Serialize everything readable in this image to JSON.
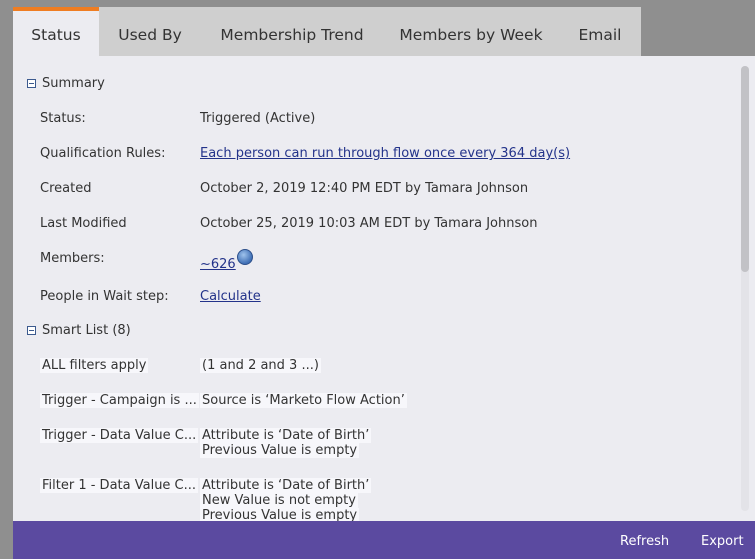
{
  "tabs": [
    {
      "label": "Status",
      "active": true
    },
    {
      "label": "Used By"
    },
    {
      "label": "Membership Trend"
    },
    {
      "label": "Members by Week"
    },
    {
      "label": "Email"
    }
  ],
  "summary": {
    "title": "Summary",
    "rows": {
      "status": {
        "label": "Status:",
        "value": "Triggered (Active)"
      },
      "qualification": {
        "label": "Qualification Rules:",
        "value": "Each person can run through flow once every 364 day(s)"
      },
      "created": {
        "label": "Created",
        "value": "October 2, 2019 12:40 PM EDT by Tamara Johnson"
      },
      "modified": {
        "label": "Last Modified",
        "value": "October 25, 2019 10:03 AM EDT by Tamara Johnson"
      },
      "members": {
        "label": "Members:",
        "value": "~626"
      },
      "wait": {
        "label": "People in Wait step:",
        "value": "Calculate"
      }
    }
  },
  "smart_list": {
    "title": "Smart List (8)",
    "rows": [
      {
        "label": "ALL filters apply",
        "lines": [
          "(1 and 2 and 3 ...)"
        ]
      },
      {
        "label": "Trigger - Campaign is ...",
        "lines": [
          "Source is ‘Marketo Flow Action’"
        ]
      },
      {
        "label": "Trigger - Data Value C...",
        "lines": [
          "Attribute is ‘Date of Birth’",
          "Previous Value is empty"
        ]
      },
      {
        "label": "Filter 1 - Data Value C...",
        "lines": [
          "Attribute is ‘Date of Birth’",
          "New Value is not empty",
          "Previous Value is empty"
        ]
      }
    ]
  },
  "actions": {
    "refresh": "Refresh",
    "export": "Export"
  },
  "colors": {
    "tab_accent": "#ef7d22",
    "bottom_bar": "#5b4aa0",
    "link": "#23338a"
  }
}
